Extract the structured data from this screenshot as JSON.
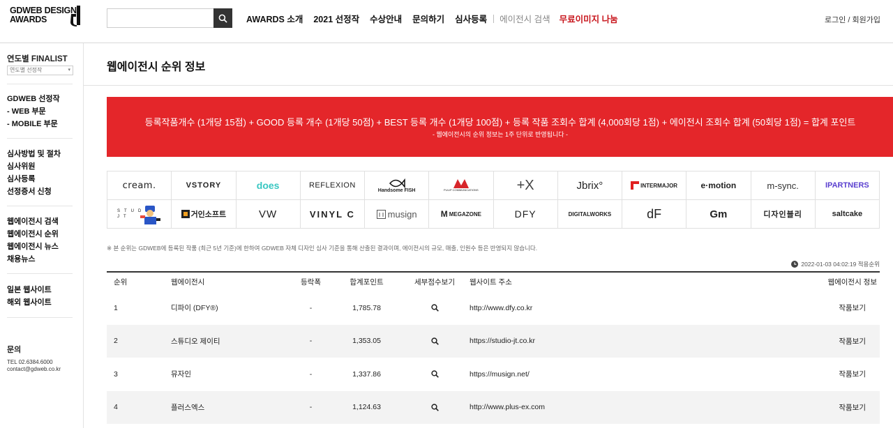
{
  "header": {
    "logo_line1": "GDWEB DESIGN",
    "logo_line2": "AWARDS",
    "search_placeholder": "",
    "nav": [
      {
        "label": "AWARDS 소개"
      },
      {
        "label": "2021 선정작"
      },
      {
        "label": "수상안내"
      },
      {
        "label": "문의하기"
      },
      {
        "label": "심사등록"
      },
      {
        "label": "에이전시 검색"
      },
      {
        "label": "무료이미지 나눔"
      }
    ],
    "login": "로그인",
    "divider": "/",
    "signup": "회원가입"
  },
  "sidebar": {
    "title": "연도별 FINALIST",
    "select_value": "연도별 선정작",
    "group1": [
      "GDWEB 선정작",
      "- WEB 부문",
      "- MOBILE 부문"
    ],
    "group2": [
      "심사방법 및 절차",
      "심사위원",
      "심사등록",
      "선정증서 신청"
    ],
    "group3": [
      "웹에이전시 검색",
      "웹에이전시 순위",
      "웹에이전시 뉴스",
      "채용뉴스"
    ],
    "group4": [
      "일본 웹사이트",
      "해외 웹사이트"
    ],
    "contact_title": "문의",
    "contact_tel": "TEL 02.6384.6000",
    "contact_email": "contact@gdweb.co.kr"
  },
  "main": {
    "page_title": "웹에이전시 순위 정보",
    "banner_line1": "등록작품개수 (1개당 15점) + GOOD 등록 개수 (1개당 50점) + BEST 등록 개수 (1개당 100점) + 등록 작품 조회수 합계 (4,000회당 1점) + 에이전시 조회수 합계 (50회당 1점) = 합계 포인트",
    "banner_line2": "- 웹에이전시의 순위 정보는 1주 단위로 반영됩니다 -",
    "banner_color": "#e4262a",
    "logos": [
      "cream.",
      "VSTORY",
      "does",
      "REFLEXION",
      "Handsome FISH",
      "PULIP COMMUNICATIONS",
      "+X",
      "Jbrix°",
      "INTERMAJOR",
      "e·motion",
      "m-sync.",
      "IPARTNERS",
      "STUDIO JT",
      "거인소프트",
      "VW",
      "VINYL C",
      "musign",
      "MEGAZONE",
      "DFY",
      "DIGITALWORKS",
      "dF",
      "Gm",
      "디자인블리",
      "saltcake"
    ],
    "note": "※ 본 순위는 GDWEB에 등록된 작품 (최근 5년 기준)에 한하여 GDWEB 자체 디자인 심사 기준을 통해 산출된 결과이며, 에이전시의 규모, 매출, 인원수 등은 반영되지 않습니다.",
    "date": "2022-01-03 04:02:19 적용순위",
    "columns": [
      "순위",
      "웹에이전시",
      "등락폭",
      "합계포인트",
      "세부점수보기",
      "웹사이트 주소",
      "웹에이전시 정보"
    ],
    "rows": [
      {
        "rank": "1",
        "name": "디파이 (DFY®)",
        "change": "-",
        "points": "1,785.78",
        "url": "http://www.dfy.co.kr",
        "info": "작품보기"
      },
      {
        "rank": "2",
        "name": "스튜디오 제이티",
        "change": "-",
        "points": "1,353.05",
        "url": "https://studio-jt.co.kr",
        "info": "작품보기"
      },
      {
        "rank": "3",
        "name": "뮤자인",
        "change": "-",
        "points": "1,337.86",
        "url": "https://musign.net/",
        "info": "작품보기"
      },
      {
        "rank": "4",
        "name": "플러스엑스",
        "change": "-",
        "points": "1,124.63",
        "url": "http://www.plus-ex.com",
        "info": "작품보기"
      }
    ]
  }
}
